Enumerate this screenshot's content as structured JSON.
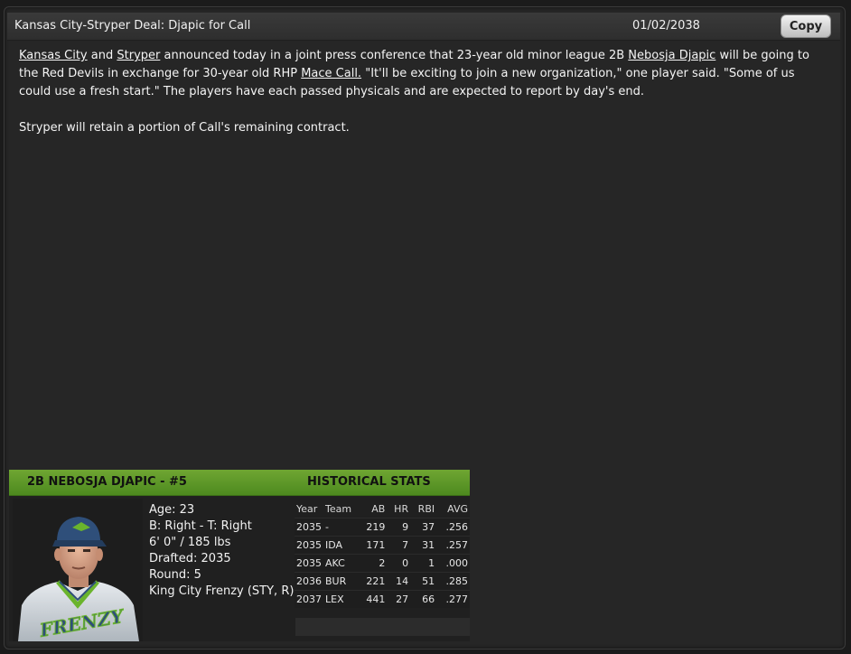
{
  "window": {
    "title": "Kansas City-Stryper Deal: Djapic for Call",
    "date": "01/02/2038",
    "copy_label": "Copy"
  },
  "article": {
    "p1": {
      "team1": "Kansas City",
      "and": " and ",
      "team2": "Stryper",
      "t1": " announced today in a joint press conference that 23-year old minor league 2B ",
      "player1": "Nebosja Djapic",
      "t2": " will be going to the Red Devils in exchange for 30-year old RHP ",
      "player2": "Mace Call.",
      "t3": " \"It'll be exciting to join a new organization,\" one player said. \"Some of us could use a fresh start.\" The players have each passed physicals and are expected to report by day's end."
    },
    "p2": "Stryper will retain a portion of Call's remaining contract."
  },
  "player_card": {
    "header": "2B NEBOSJA DJAPIC - #5",
    "stats_title": "HISTORICAL STATS",
    "bio": {
      "age": "Age: 23",
      "bats_throws": "B: Right - T: Right",
      "size": "6' 0\" / 185 lbs",
      "drafted": "Drafted: 2035",
      "round": "Round: 5",
      "team": "King City Frenzy (STY, R)"
    },
    "portrait": {
      "cap_color": "#2f4f7a",
      "jersey_color": "#d8dde2",
      "trim_color": "#6ab42c",
      "jersey_text": "FRENZY"
    },
    "stats": {
      "headers": [
        "Year",
        "Team",
        "AB",
        "HR",
        "RBI",
        "AVG"
      ],
      "rows": [
        [
          "2035",
          "-",
          "219",
          "9",
          "37",
          ".256"
        ],
        [
          "2035",
          "IDA",
          "171",
          "7",
          "31",
          ".257"
        ],
        [
          "2035",
          "AKC",
          "2",
          "0",
          "1",
          ".000"
        ],
        [
          "2036",
          "BUR",
          "221",
          "14",
          "51",
          ".285"
        ],
        [
          "2037",
          "LEX",
          "441",
          "27",
          "66",
          ".277"
        ]
      ]
    }
  }
}
